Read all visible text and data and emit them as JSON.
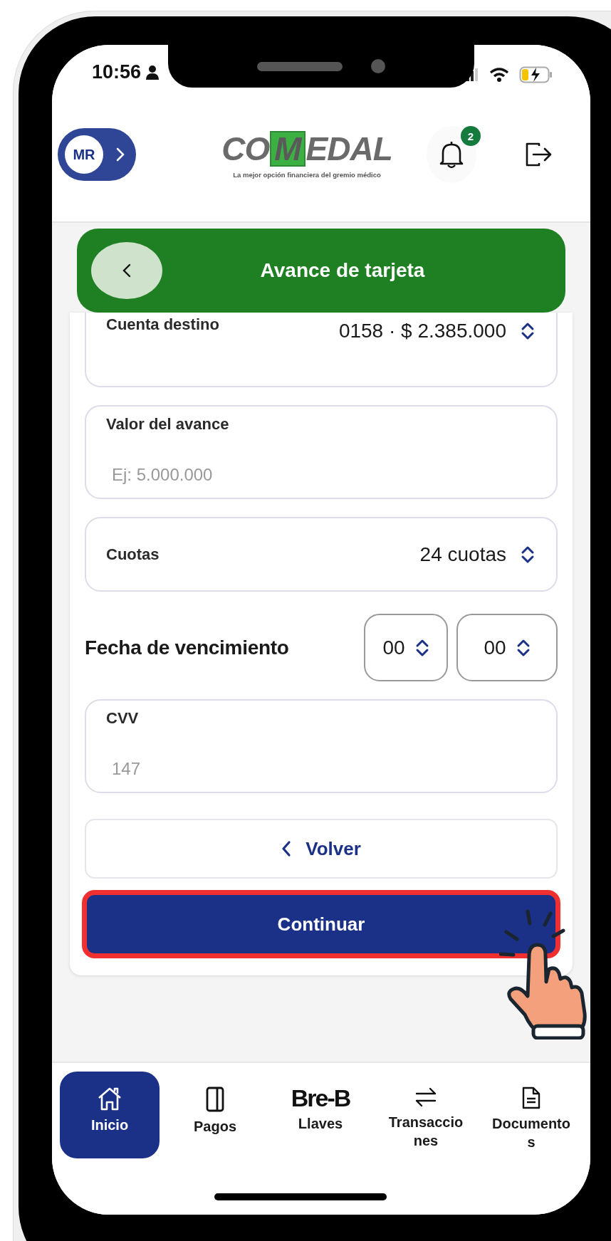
{
  "status_bar": {
    "time": "10:56"
  },
  "header": {
    "avatar_initials": "MR",
    "logo": {
      "before": "CO",
      "highlight": "M",
      "after": "EDAL",
      "tagline": "La mejor opción financiera del gremio médico"
    },
    "notification_count": "2"
  },
  "title_bar": {
    "title": "Avance de tarjeta"
  },
  "form": {
    "fields": [
      {
        "kind": "select",
        "label": "Cuenta destino",
        "value": "0158 · $ 2.385.000"
      },
      {
        "kind": "input",
        "label": "Valor del avance",
        "placeholder": "Ej: 5.000.000"
      },
      {
        "kind": "select",
        "label": "Cuotas",
        "value": "24 cuotas"
      },
      {
        "kind": "date",
        "label": "Fecha de vencimiento",
        "values": [
          "00",
          "00"
        ]
      },
      {
        "kind": "input",
        "label": "CVV",
        "placeholder": "147"
      }
    ]
  },
  "buttons": [
    {
      "kind": "secondary",
      "label": "Volver",
      "highlighted": false
    },
    {
      "kind": "primary",
      "label": "Continuar",
      "highlighted": true
    }
  ],
  "bottom_nav": [
    {
      "kind": "home",
      "label": "Inicio",
      "selected": true
    },
    {
      "kind": "card",
      "label": "Pagos",
      "selected": false
    },
    {
      "kind": "logo",
      "logo": "Bre-B",
      "label": "Llaves",
      "selected": false
    },
    {
      "kind": "arrows",
      "label": "Transacciones",
      "selected": false
    },
    {
      "kind": "document",
      "label": "Documentos",
      "selected": false
    }
  ]
}
